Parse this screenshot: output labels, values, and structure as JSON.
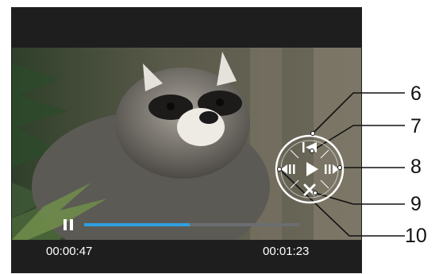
{
  "player": {
    "elapsed": "00:00:47",
    "duration": "00:01:23",
    "progress_fraction": 0.49
  },
  "callouts": [
    "6",
    "7",
    "8",
    "9",
    "10"
  ],
  "dial": {
    "buttons": [
      "skip-to-start-icon",
      "play-icon",
      "fast-forward-icon",
      "stop-icon",
      "rewind-icon"
    ]
  },
  "colors": {
    "progress": "#2f9fe0",
    "track": "#6b6e70",
    "frame": "#1e1e1e"
  }
}
